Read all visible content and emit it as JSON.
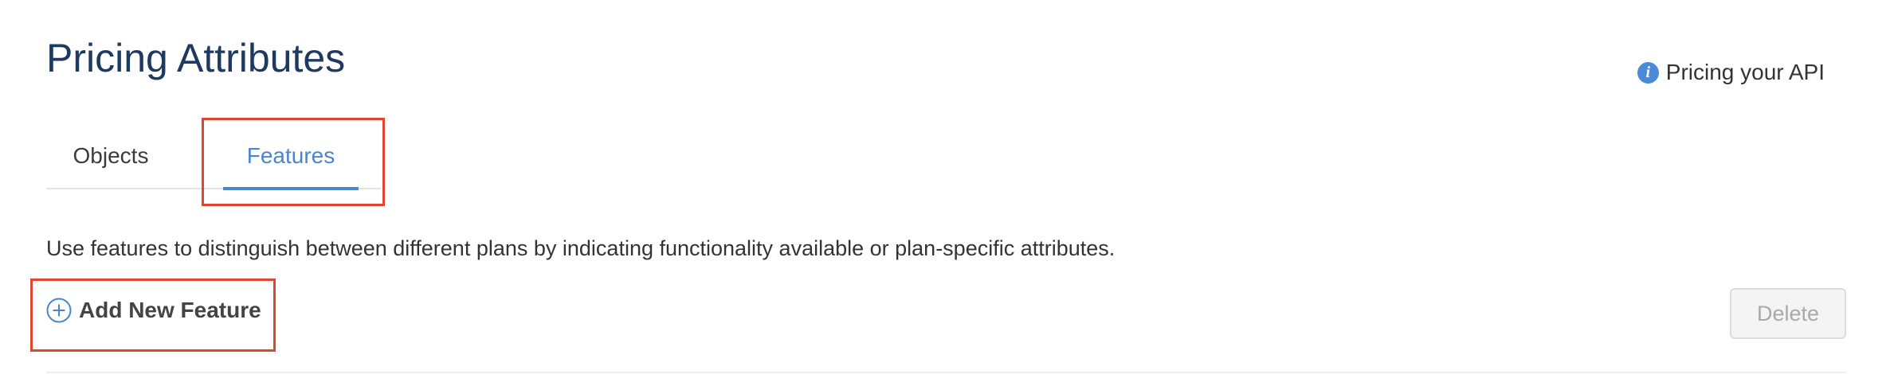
{
  "header": {
    "title": "Pricing Attributes",
    "help_link": {
      "label": "Pricing your API",
      "icon": "info-icon"
    }
  },
  "tabs": [
    {
      "label": "Objects",
      "active": false
    },
    {
      "label": "Features",
      "active": true
    }
  ],
  "description": "Use features to distinguish between different plans by indicating functionality available or plan-specific attributes.",
  "actions": {
    "add_label": "Add New Feature",
    "add_icon": "plus-circle-icon",
    "delete_label": "Delete",
    "delete_enabled": false
  },
  "colors": {
    "title": "#1f3a60",
    "accent": "#4a86d0",
    "highlight": "#e0452f"
  }
}
